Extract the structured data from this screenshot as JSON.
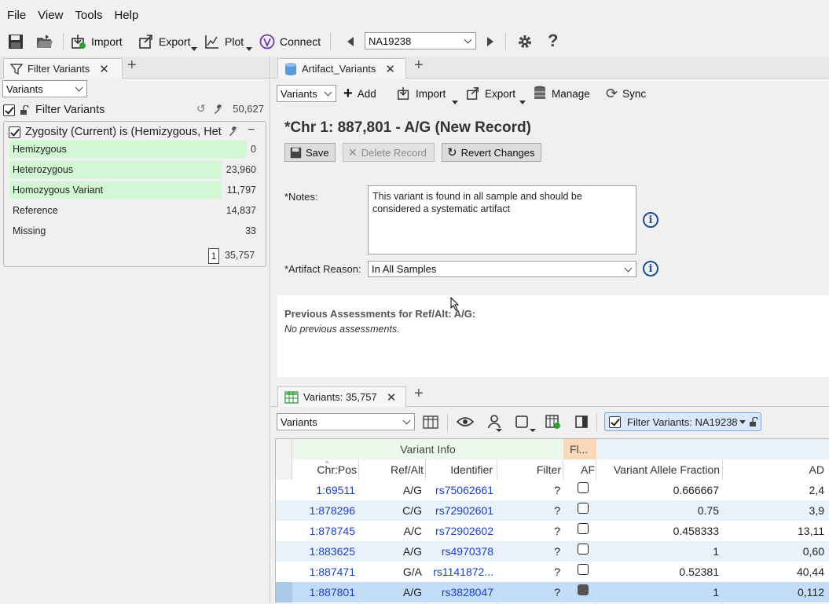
{
  "menu": [
    "File",
    "View",
    "Tools",
    "Help"
  ],
  "toolbar": {
    "import": "Import",
    "export": "Export",
    "plot": "Plot",
    "connect": "Connect",
    "sample": "NA19238"
  },
  "left": {
    "tab": "Filter Variants",
    "source_select": "Variants",
    "filter_title": "Filter Variants",
    "filter_count": "50,627",
    "card_title": "Zygosity (Current) is (Hemizygous, Het",
    "rows": [
      {
        "label": "Hemizygous",
        "count": "0",
        "fill": 1.0
      },
      {
        "label": "Heterozygous",
        "count": "23,960",
        "fill": 0.9
      },
      {
        "label": "Homozygous Variant",
        "count": "11,797",
        "fill": 0.9
      },
      {
        "label": "Reference",
        "count": "14,837",
        "fill": 0
      },
      {
        "label": "Missing",
        "count": "33",
        "fill": 0
      }
    ],
    "footer_badge": "1",
    "footer_count": "35,757"
  },
  "right": {
    "tab": "Artifact_Variants",
    "source_select": "Variants",
    "tools": {
      "add": "Add",
      "import": "Import",
      "export": "Export",
      "manage": "Manage",
      "sync": "Sync"
    },
    "record_title": "*Chr 1: 887,801 - A/G (New Record)",
    "buttons": {
      "save": "Save",
      "delete": "Delete Record",
      "revert": "Revert Changes"
    },
    "notes_label": "*Notes:",
    "notes_value": "This variant is found in all sample and should be considered a systematic artifact",
    "reason_label": "*Artifact Reason:",
    "reason_value": "In All Samples",
    "prev_title": "Previous Assessments for Ref/Alt: A/G:",
    "prev_empty": "No previous assessments."
  },
  "bottom": {
    "tab": "Variants: 35,757",
    "source_select": "Variants",
    "filter_chip": "Filter Variants: NA19238",
    "group_info": "Variant Info",
    "group_fl": "Fl...",
    "columns": [
      "Chr:Pos",
      "Ref/Alt",
      "Identifier",
      "Filter",
      "AF",
      "Variant Allele Fraction",
      "AD"
    ],
    "rows": [
      {
        "pos": "1:69511",
        "refalt": "A/G",
        "id": "rs75062661",
        "filter": "?",
        "af": false,
        "vaf": "0.666667",
        "ad": "2,4"
      },
      {
        "pos": "1:878296",
        "refalt": "C/G",
        "id": "rs72902601",
        "filter": "?",
        "af": false,
        "vaf": "0.75",
        "ad": "3,9"
      },
      {
        "pos": "1:878745",
        "refalt": "A/C",
        "id": "rs72902602",
        "filter": "?",
        "af": false,
        "vaf": "0.458333",
        "ad": "13,11"
      },
      {
        "pos": "1:883625",
        "refalt": "A/G",
        "id": "rs4970378",
        "filter": "?",
        "af": false,
        "vaf": "1",
        "ad": "0,60"
      },
      {
        "pos": "1:887471",
        "refalt": "G/A",
        "id": "rs1141872...",
        "filter": "?",
        "af": false,
        "vaf": "0.52381",
        "ad": "40,44"
      },
      {
        "pos": "1:887801",
        "refalt": "A/G",
        "id": "rs3828047",
        "filter": "?",
        "af": true,
        "vaf": "1",
        "ad": "0,112"
      }
    ]
  }
}
